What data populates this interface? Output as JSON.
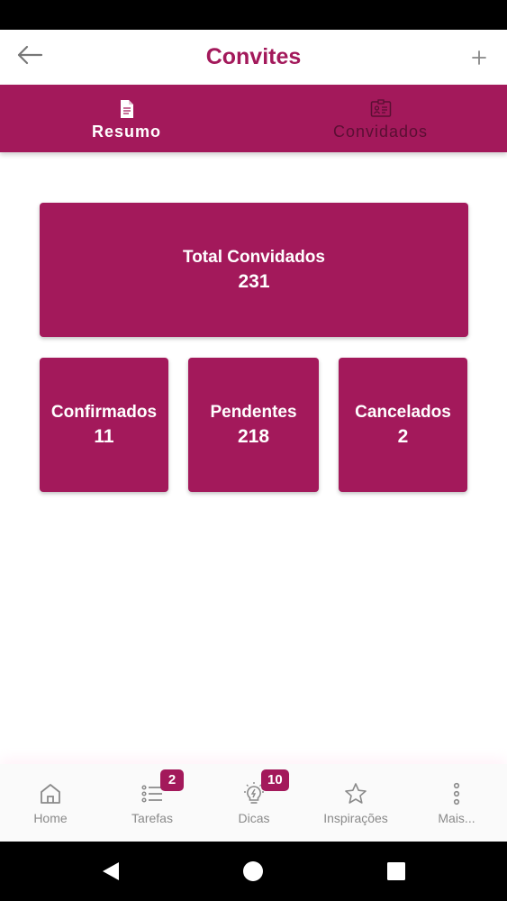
{
  "header": {
    "title": "Convites",
    "back_icon": "arrow-left-icon",
    "add_icon": "plus-icon"
  },
  "tabs": [
    {
      "label": "Resumo",
      "icon": "document-icon",
      "active": true
    },
    {
      "label": "Convidados",
      "icon": "id-card-icon",
      "active": false
    }
  ],
  "summary": {
    "total": {
      "label": "Total Convidados",
      "value": "231"
    },
    "confirmados": {
      "label": "Confirmados",
      "value": "11"
    },
    "pendentes": {
      "label": "Pendentes",
      "value": "218"
    },
    "cancelados": {
      "label": "Cancelados",
      "value": "2"
    }
  },
  "bottom_nav": [
    {
      "label": "Home",
      "icon": "home-icon"
    },
    {
      "label": "Tarefas",
      "icon": "checklist-icon",
      "badge": "2"
    },
    {
      "label": "Dicas",
      "icon": "lightbulb-icon",
      "badge": "10"
    },
    {
      "label": "Inspirações",
      "icon": "star-icon"
    },
    {
      "label": "Mais...",
      "icon": "more-vertical-icon"
    }
  ],
  "colors": {
    "primary": "#A3195B",
    "nav_label": "#8a8a8a"
  }
}
